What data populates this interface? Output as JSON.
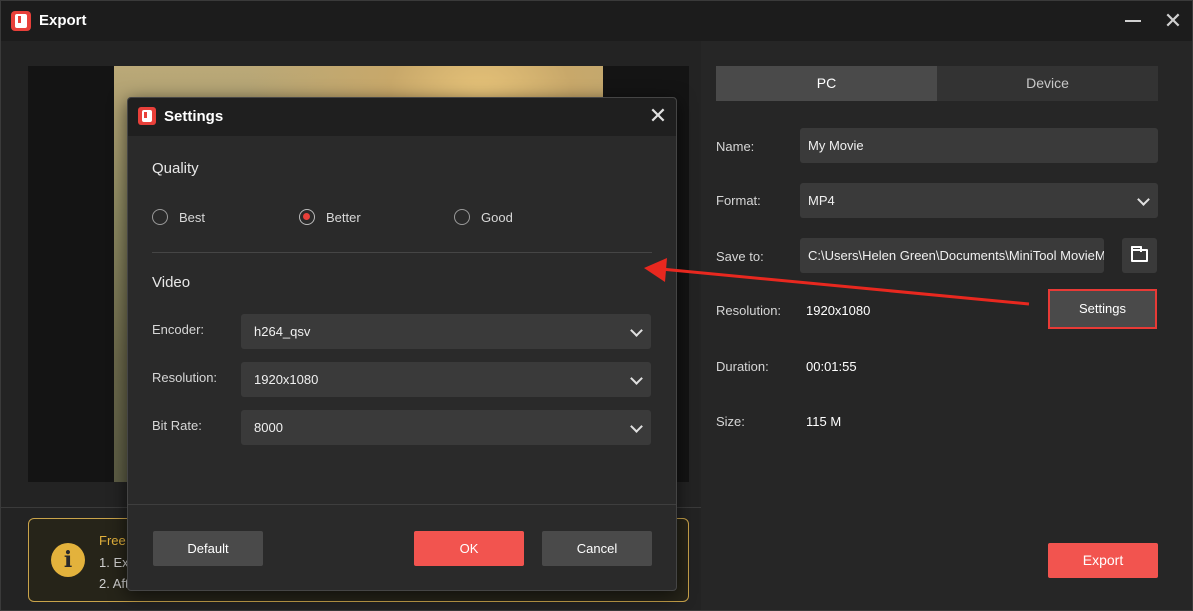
{
  "window": {
    "title": "Export"
  },
  "info": {
    "title": "Free",
    "line1": "1. Ex",
    "line2": "2. Aft"
  },
  "tabs": [
    {
      "label": "PC",
      "active": true
    },
    {
      "label": "Device",
      "active": false
    }
  ],
  "form": {
    "name_label": "Name:",
    "name_value": "My Movie",
    "format_label": "Format:",
    "format_value": "MP4",
    "save_label": "Save to:",
    "save_value": "C:\\Users\\Helen Green\\Documents\\MiniTool MovieM",
    "resolution_label": "Resolution:",
    "resolution_value": "1920x1080",
    "settings_button": "Settings",
    "duration_label": "Duration:",
    "duration_value": "00:01:55",
    "size_label": "Size:",
    "size_value": "115 M"
  },
  "export_button": "Export",
  "settings_dialog": {
    "title": "Settings",
    "quality_title": "Quality",
    "quality_options": [
      {
        "label": "Best",
        "selected": false
      },
      {
        "label": "Better",
        "selected": true
      },
      {
        "label": "Good",
        "selected": false
      }
    ],
    "video_title": "Video",
    "encoder_label": "Encoder:",
    "encoder_value": "h264_qsv",
    "resolution_label": "Resolution:",
    "resolution_value": "1920x1080",
    "bitrate_label": "Bit Rate:",
    "bitrate_value": "8000",
    "default_button": "Default",
    "ok_button": "OK",
    "cancel_button": "Cancel"
  },
  "colors": {
    "accent": "#f2544f",
    "highlight_border": "#e83a36",
    "info_border": "#c9a34a"
  }
}
